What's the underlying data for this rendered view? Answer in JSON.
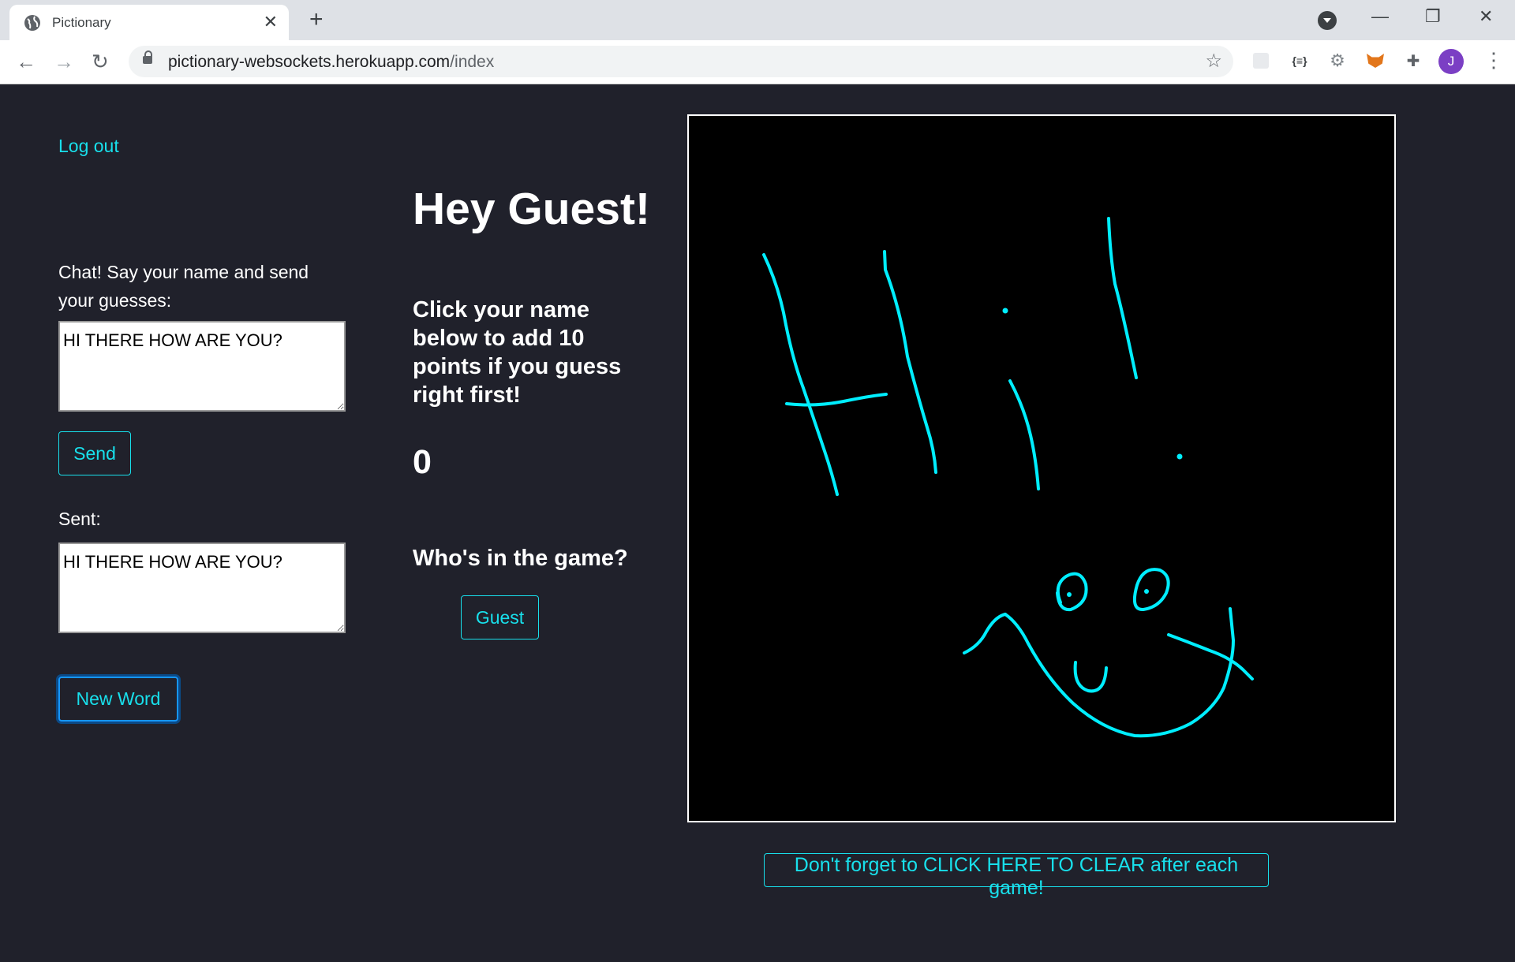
{
  "browser": {
    "tab_title": "Pictionary",
    "url_host": "pictionary-websockets.herokuapp.com",
    "url_path": "/index",
    "profile_initial": "J"
  },
  "page": {
    "logout_label": "Log out",
    "chat_label": "Chat! Say your name and send your guesses:",
    "chat_input_value": "HI THERE HOW ARE YOU?",
    "send_label": "Send",
    "sent_label": "Sent:",
    "sent_value": "HI THERE HOW ARE YOU?",
    "new_word_label": "New Word",
    "greeting": "Hey Guest!",
    "instructions": "Click your name below to add 10 points if you guess right first!",
    "score": "0",
    "players_heading": "Who's in the game?",
    "players": [
      "Guest"
    ],
    "clear_label": "Don't forget to CLICK HERE TO CLEAR after each game!"
  },
  "colors": {
    "accent": "#18e0ec",
    "background": "#20212b",
    "canvas_background": "#000000",
    "stroke": "#00eeff"
  }
}
